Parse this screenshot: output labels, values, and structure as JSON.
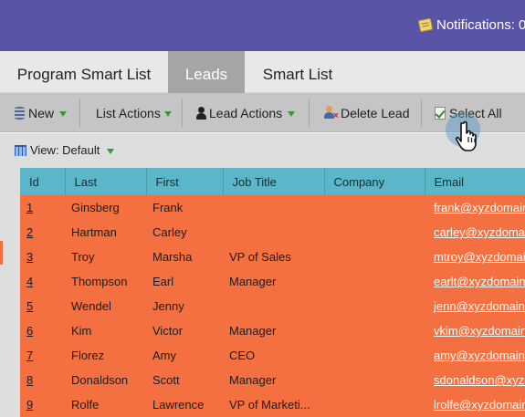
{
  "header": {
    "notifications_label": "Notifications: 0"
  },
  "tabs": [
    {
      "label": "Program Smart List"
    },
    {
      "label": "Leads",
      "active": true
    },
    {
      "label": "Smart List"
    }
  ],
  "toolbar": {
    "new_label": "New",
    "list_actions_label": "List Actions",
    "lead_actions_label": "Lead Actions",
    "delete_lead_label": "Delete Lead",
    "select_all_label": "Select All"
  },
  "view": {
    "label": "View: Default"
  },
  "table": {
    "columns": [
      "Id",
      "Last",
      "First",
      "Job Title",
      "Company",
      "Email"
    ],
    "rows": [
      {
        "id": "1",
        "last": "Ginsberg",
        "first": "Frank",
        "title": "",
        "company": "",
        "email": "frank@xyzdomain"
      },
      {
        "id": "2",
        "last": "Hartman",
        "first": "Carley",
        "title": "",
        "company": "",
        "email": "carley@xyzdomain"
      },
      {
        "id": "3",
        "last": "Troy",
        "first": "Marsha",
        "title": "VP of Sales",
        "company": "",
        "email": "mtroy@xyzdomain"
      },
      {
        "id": "4",
        "last": "Thompson",
        "first": "Earl",
        "title": "Manager",
        "company": "",
        "email": "earlt@xyzdomain"
      },
      {
        "id": "5",
        "last": "Wendel",
        "first": "Jenny",
        "title": "",
        "company": "",
        "email": "jenn@xyzdomain"
      },
      {
        "id": "6",
        "last": "Kim",
        "first": "Victor",
        "title": "Manager",
        "company": "",
        "email": "vkim@xyzdomain"
      },
      {
        "id": "7",
        "last": "Florez",
        "first": "Amy",
        "title": "CEO",
        "company": "",
        "email": "amy@xyzdomain"
      },
      {
        "id": "8",
        "last": "Donaldson",
        "first": "Scott",
        "title": "Manager",
        "company": "",
        "email": "sdonaldson@xyzdomain"
      },
      {
        "id": "9",
        "last": "Rolfe",
        "first": "Lawrence",
        "title": "VP of Marketi...",
        "company": "",
        "email": "lrolfe@xyzdomain"
      }
    ]
  },
  "colors": {
    "header_bg": "#5a54a6",
    "row_selected": "#f57040",
    "column_header": "#5ab6c8"
  },
  "icons": [
    "notifications-icon",
    "database-icon",
    "user-icon",
    "delete-lead-icon",
    "checkbox-icon",
    "grid-view-icon",
    "hand-pointer-icon"
  ]
}
